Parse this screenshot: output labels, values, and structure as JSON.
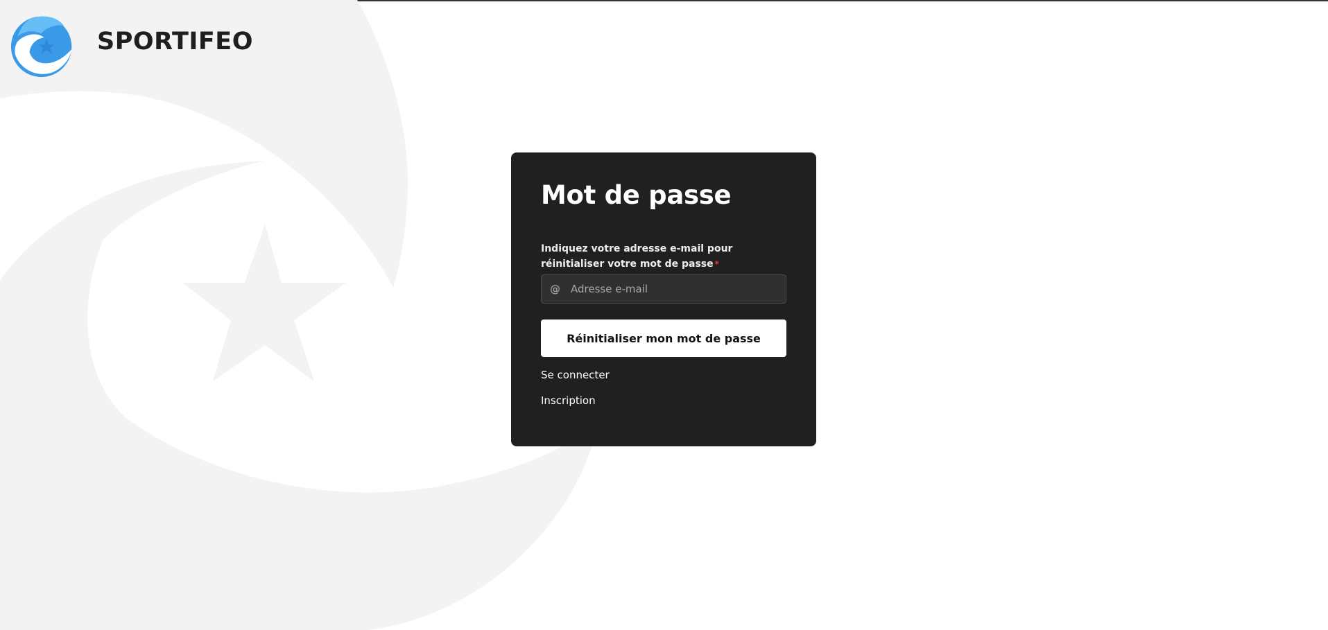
{
  "brand": {
    "name": "SPORTIFEO",
    "logo_icon": "sportifeo-logo-icon",
    "logo_colors": [
      "#2f93e6",
      "#5ab4f2",
      "#ffffff"
    ]
  },
  "background": {
    "icon": "sportifeo-watermark-icon",
    "color": "#f2f2f2"
  },
  "card": {
    "title": "Mot de passe",
    "background_color": "#202020",
    "email_label": "Indiquez votre adresse e-mail pour réinitialiser votre mot de passe",
    "required_marker": "*",
    "email_icon": "@",
    "email_placeholder": "Adresse e-mail",
    "email_value": "",
    "reset_button_label": "Réinitialiser mon mot de passe",
    "login_link": "Se connecter",
    "signup_link": "Inscription"
  }
}
